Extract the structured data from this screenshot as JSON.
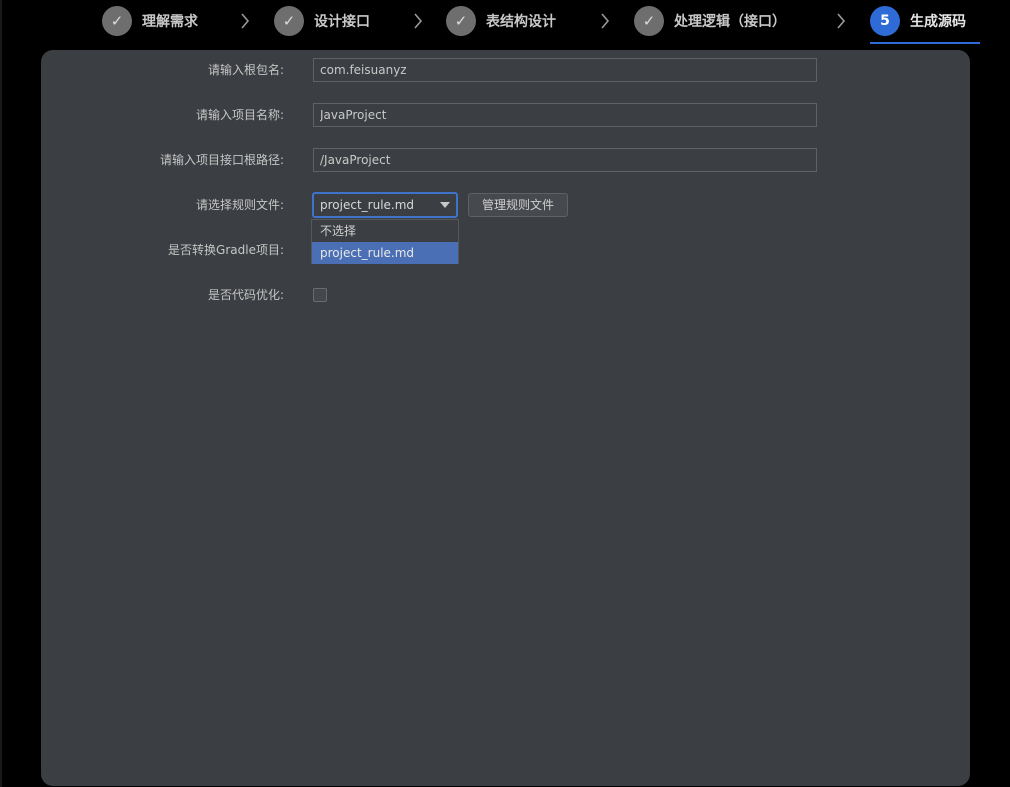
{
  "stepper": {
    "steps": [
      {
        "label": "理解需求",
        "marker": "✓"
      },
      {
        "label": "设计接口",
        "marker": "✓"
      },
      {
        "label": "表结构设计",
        "marker": "✓"
      },
      {
        "label": "处理逻辑（接口）",
        "marker": "✓"
      },
      {
        "label": "生成源码",
        "marker": "5"
      }
    ],
    "active_index": 4,
    "accent_color": "#2e6bd6"
  },
  "form": {
    "package": {
      "label": "请输入根包名:",
      "value": "com.feisuanyz"
    },
    "project_name": {
      "label": "请输入项目名称:",
      "value": "JavaProject"
    },
    "api_root": {
      "label": "请输入项目接口根路径:",
      "value": "/JavaProject"
    },
    "rule_file": {
      "label": "请选择规则文件:",
      "selected": "project_rule.md",
      "options": [
        "不选择",
        "project_rule.md"
      ],
      "manage_button": "管理规则文件"
    },
    "gradle": {
      "label": "是否转换Gradle项目:"
    },
    "optimize": {
      "label": "是否代码优化:",
      "checked": false
    }
  }
}
